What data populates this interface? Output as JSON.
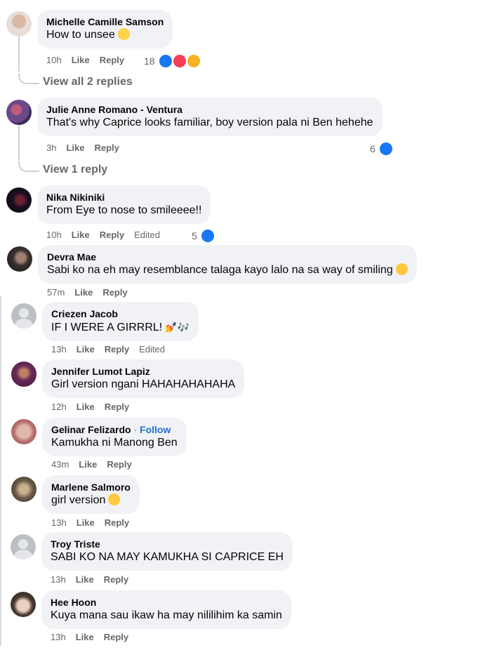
{
  "comments": [
    {
      "name": "Michelle Camille Samson",
      "text": "How to unsee",
      "time": "10h",
      "like": "Like",
      "reply": "Reply",
      "reactions": "18",
      "emoji": "😨"
    },
    {
      "name": "Julie Anne Romano - Ventura",
      "text": "That's why Caprice looks familiar, boy version pala ni Ben hehehe",
      "time": "3h",
      "like": "Like",
      "reply": "Reply",
      "reactions": "6"
    },
    {
      "name": "Nika Nikiniki",
      "text": "From Eye to nose to smileeee!!",
      "time": "10h",
      "like": "Like",
      "reply": "Reply",
      "edited": "Edited",
      "reactions": "5"
    },
    {
      "name": "Devra Mae",
      "text": "Sabi ko na eh may resemblance talaga kayo lalo na sa way of smiling",
      "time": "57m",
      "like": "Like",
      "reply": "Reply",
      "emoji": "😌"
    },
    {
      "name": "Criezen Jacob",
      "text": "IF I WERE A GIRRRL!",
      "time": "13h",
      "like": "Like",
      "reply": "Reply",
      "edited": "Edited",
      "emoji": "💅🎶"
    },
    {
      "name": "Jennifer Lumot Lapiz",
      "text": "Girl version ngani HAHAHAHAHAHA",
      "time": "12h",
      "like": "Like",
      "reply": "Reply"
    },
    {
      "name": "Gelinar Felizardo",
      "follow": "Follow",
      "text": "Kamukha ni Manong Ben",
      "time": "43m",
      "like": "Like",
      "reply": "Reply"
    },
    {
      "name": "Marlene Salmoro",
      "text": "girl version",
      "time": "13h",
      "like": "Like",
      "reply": "Reply",
      "emoji": "😊"
    },
    {
      "name": "Troy Triste",
      "text": "SABI KO NA MAY KAMUKHA SI CAPRICE EH",
      "time": "13h",
      "like": "Like",
      "reply": "Reply"
    },
    {
      "name": "Hee Hoon",
      "text": "Kuya mana sau ikaw ha may nililihim ka samin",
      "time": "13h",
      "like": "Like",
      "reply": "Reply"
    }
  ],
  "view_replies": [
    "View all 2 replies",
    "View 1 reply"
  ],
  "colors": {
    "bubble": "#f0f2f5",
    "muted": "#65676b",
    "link": "#216fdb",
    "like_blue": "#1877f2"
  }
}
